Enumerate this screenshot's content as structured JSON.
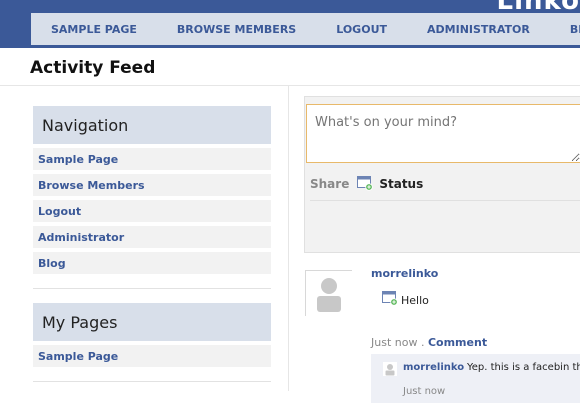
{
  "brand": {
    "text": "Linko"
  },
  "top_nav": {
    "items": [
      {
        "label": "SAMPLE PAGE"
      },
      {
        "label": "BROWSE MEMBERS"
      },
      {
        "label": "LOGOUT"
      },
      {
        "label": "ADMINISTRATOR"
      },
      {
        "label": "BLOG"
      }
    ]
  },
  "page": {
    "title": "Activity Feed"
  },
  "sidebar": {
    "navigation": {
      "heading": "Navigation",
      "items": [
        {
          "label": "Sample Page"
        },
        {
          "label": "Browse Members"
        },
        {
          "label": "Logout"
        },
        {
          "label": "Administrator"
        },
        {
          "label": "Blog"
        }
      ]
    },
    "my_pages": {
      "heading": "My Pages",
      "items": [
        {
          "label": "Sample Page"
        }
      ]
    }
  },
  "composer": {
    "placeholder": "What's on your mind?",
    "share_label": "Share",
    "status_label": "Status",
    "status_icon": "status-icon"
  },
  "feed": {
    "post": {
      "author": "morrelinko",
      "text": "Hello",
      "time": "Just now",
      "separator": ".",
      "comment_link": "Comment",
      "icon": "status-icon"
    },
    "comment": {
      "author": "morrelinko",
      "text": "Yep. this is a facebin th",
      "time": "Just now"
    }
  },
  "colors": {
    "brand_blue": "#3b5998",
    "nav_bg": "#d8dfea",
    "input_border": "#e8b96a"
  }
}
